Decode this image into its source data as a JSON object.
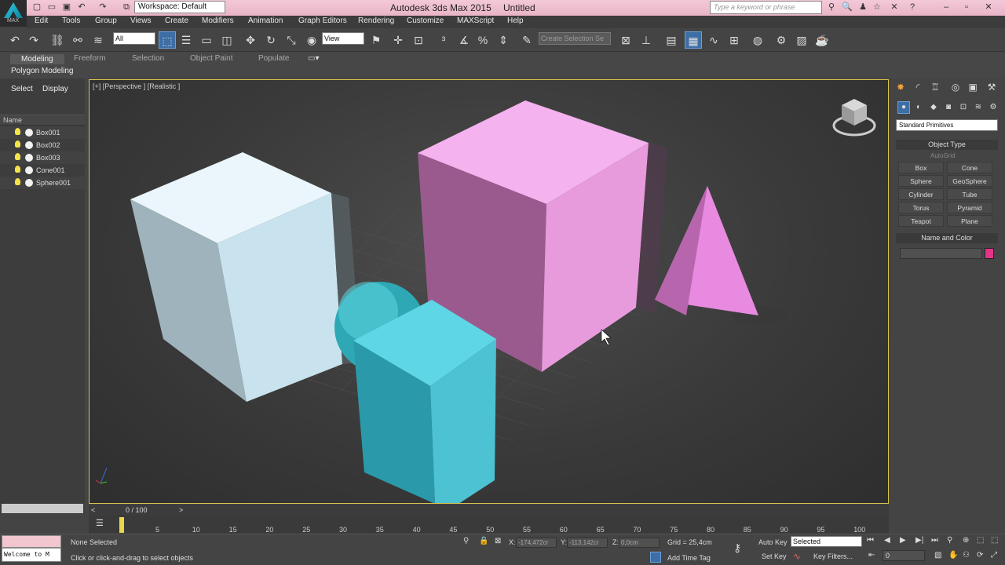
{
  "title_bar": {
    "workspace": "Workspace: Default",
    "app_title": "Autodesk 3ds Max  2015",
    "document": "Untitled",
    "search_placeholder": "Type a keyword or phrase"
  },
  "logo_text": "MAX",
  "menu": [
    "Edit",
    "Tools",
    "Group",
    "Views",
    "Create",
    "Modifiers",
    "Animation",
    "Graph Editors",
    "Rendering",
    "Customize",
    "MAXScript",
    "Help"
  ],
  "toolbar": {
    "filter": "All",
    "ref_coord": "View",
    "selection_set": "Create Selection Se"
  },
  "ribbon": {
    "tabs": [
      "Modeling",
      "Freeform",
      "Selection",
      "Object Paint",
      "Populate"
    ],
    "sub_label": "Polygon Modeling"
  },
  "explorer": {
    "tabs": [
      "Select",
      "Display"
    ],
    "column_header": "Name",
    "objects": [
      "Box001",
      "Box002",
      "Box003",
      "Cone001",
      "Sphere001"
    ]
  },
  "viewport": {
    "label": "[+] [Perspective ] [Realistic ]",
    "colors": {
      "white_box": "#c9e3ee",
      "pink": "#f2a0e6",
      "cyan": "#48c8d8"
    }
  },
  "command_panel": {
    "category": "Standard Primitives",
    "object_type_title": "Object Type",
    "autogrid": "AutoGrid",
    "buttons": [
      "Box",
      "Cone",
      "Sphere",
      "GeoSphere",
      "Cylinder",
      "Tube",
      "Torus",
      "Pyramid",
      "Teapot",
      "Plane"
    ],
    "name_color_title": "Name and Color",
    "object_color": "#e2358a"
  },
  "time": {
    "frame_counter": "0 / 100",
    "ticks": [
      "5",
      "10",
      "15",
      "20",
      "25",
      "30",
      "35",
      "40",
      "45",
      "50",
      "55",
      "60",
      "65",
      "70",
      "75",
      "80",
      "85",
      "90",
      "95",
      "100"
    ]
  },
  "status": {
    "listener": "Welcome to M",
    "selection": "None Selected",
    "prompt": "Click or click-and-drag to select objects",
    "x_label": "X:",
    "x": "-174,472cr",
    "y_label": "Y:",
    "y": "-113,142cr",
    "z_label": "Z:",
    "z": "0,0cm",
    "grid": "Grid = 25,4cm",
    "add_time_tag": "Add Time Tag",
    "auto_key": "Auto Key",
    "set_key": "Set Key",
    "key_mode": "Selected",
    "key_filters": "Key Filters...",
    "current_frame": "0"
  }
}
